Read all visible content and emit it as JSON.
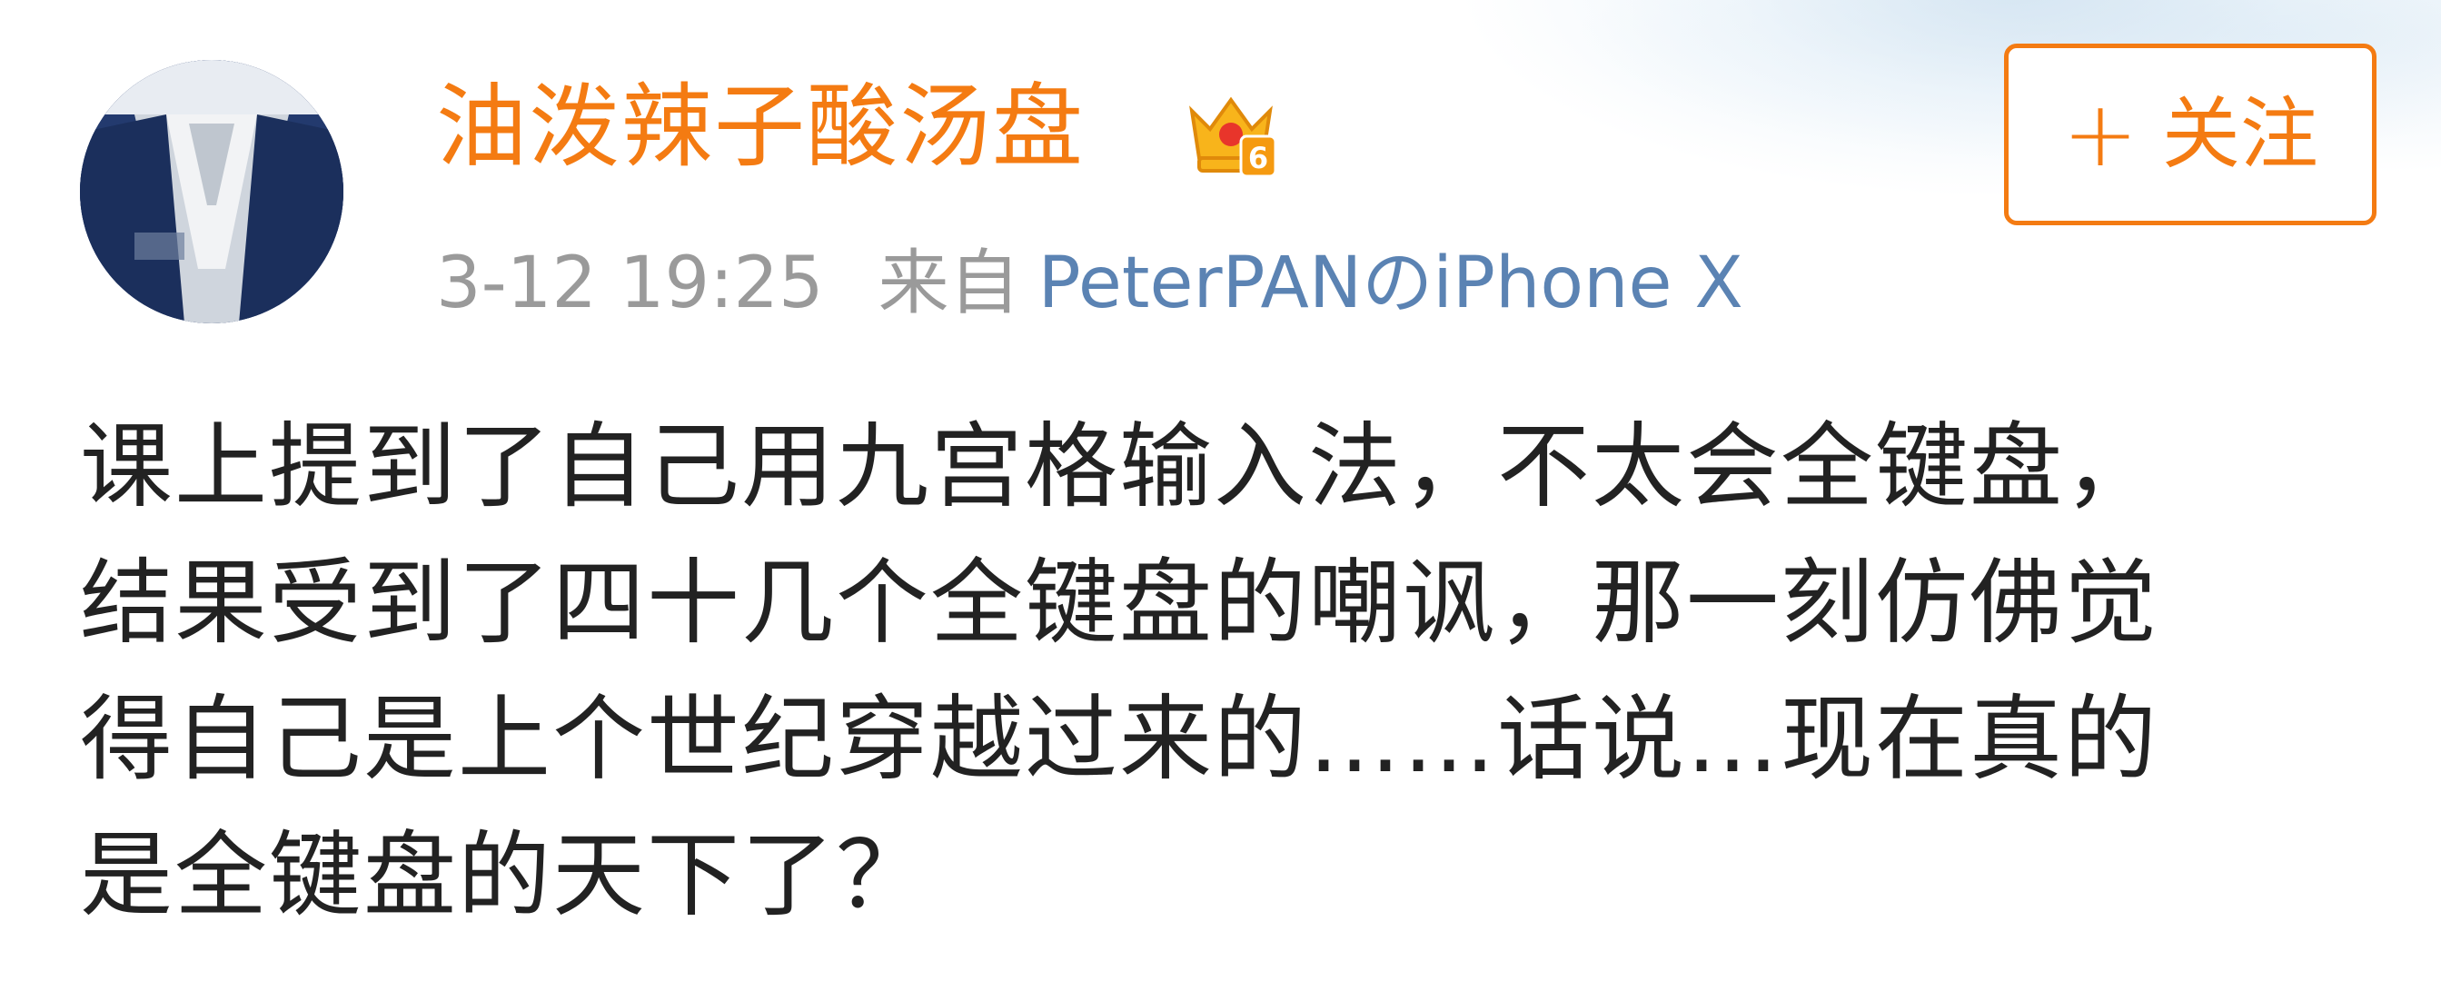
{
  "post": {
    "username": "油泼辣子酸汤盘",
    "badge_icon": "crown-vip-icon",
    "badge_level": "6",
    "follow_icon": "plus-icon",
    "follow_label": "关注",
    "time": "3-12 19:25",
    "source_prefix": "来自",
    "source_device": "PeterPANのiPhone X",
    "body_lines": [
      "课上提到了自己用九宫格输入法，不太会全键盘，",
      "结果受到了四十几个全键盘的嘲讽，那一刻仿佛觉",
      "得自己是上个世纪穿越过来的……话说…现在真的",
      "是全键盘的天下了？"
    ]
  },
  "colors": {
    "accent_orange": "#f47b12",
    "link_blue": "#5b83b3",
    "meta_gray": "#9a9a9a",
    "body_text": "#222222"
  }
}
